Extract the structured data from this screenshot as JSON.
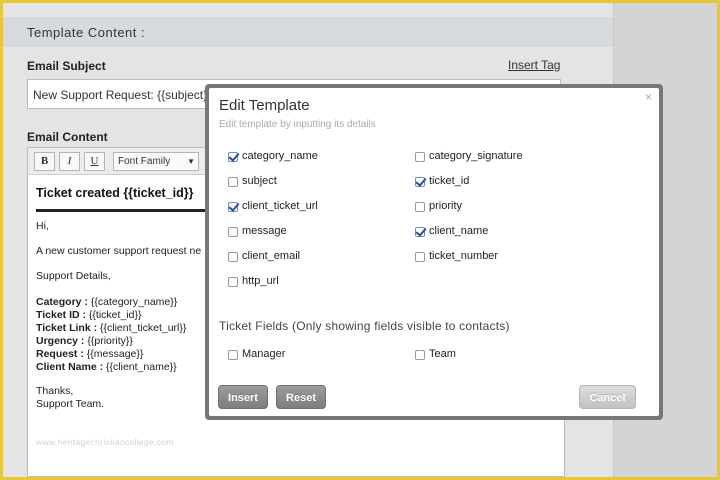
{
  "background": {
    "section_title": "Template Content :",
    "email_subject_label": "Email Subject",
    "insert_tag": "Insert Tag",
    "subject_value": "New Support Request: {{subject}}",
    "email_content_label": "Email Content",
    "toolbar": {
      "bold": "B",
      "italic": "I",
      "underline": "U",
      "font_family": "Font Family"
    },
    "content": {
      "heading": "Ticket created {{ticket_id}}",
      "hi": "Hi,",
      "intro": "A new customer support request ne",
      "support_details": "Support Details,",
      "lines": [
        {
          "label": "Category :",
          "value": " {{category_name}}"
        },
        {
          "label": "Ticket ID :",
          "value": " {{ticket_id}}"
        },
        {
          "label": "Ticket Link :",
          "value": " {{client_ticket_url}}"
        },
        {
          "label": "Urgency :",
          "value": " {{priority}}"
        },
        {
          "label": "Request :",
          "value": " {{message}}"
        },
        {
          "label": "Client Name :",
          "value": " {{client_name}}"
        }
      ],
      "thanks": "Thanks,",
      "team": "Support Team."
    },
    "watermark": "www.heritagechristiancollege.com"
  },
  "modal": {
    "title": "Edit Template",
    "subtitle": "Edit template by inputting its details",
    "close": "×",
    "options_left": [
      {
        "label": "category_name",
        "checked": true
      },
      {
        "label": "subject",
        "checked": false
      },
      {
        "label": "client_ticket_url",
        "checked": true
      },
      {
        "label": "message",
        "checked": false
      },
      {
        "label": "client_email",
        "checked": false
      },
      {
        "label": "http_url",
        "checked": false
      }
    ],
    "options_right": [
      {
        "label": "category_signature",
        "checked": false
      },
      {
        "label": "ticket_id",
        "checked": true
      },
      {
        "label": "priority",
        "checked": false
      },
      {
        "label": "client_name",
        "checked": true
      },
      {
        "label": "ticket_number",
        "checked": false
      }
    ],
    "ticket_fields_heading": "Ticket Fields (Only showing fields visible to contacts)",
    "ticket_fields": [
      {
        "label": "Manager",
        "checked": false
      },
      {
        "label": "Team",
        "checked": false
      }
    ],
    "buttons": {
      "insert": "Insert",
      "reset": "Reset",
      "cancel": "Cancel"
    }
  }
}
